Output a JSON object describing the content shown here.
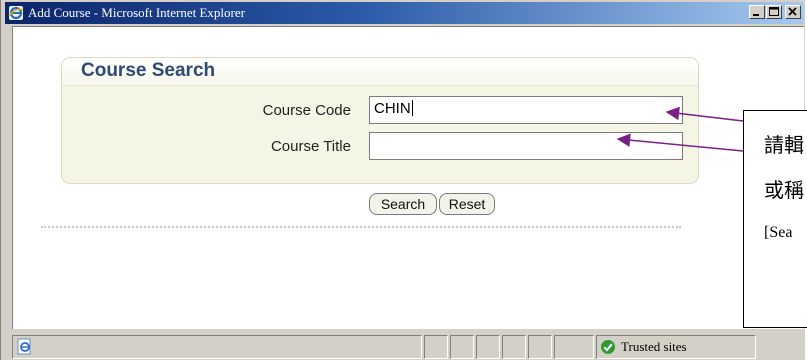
{
  "window": {
    "title": "Add Course - Microsoft Internet Explorer"
  },
  "panel": {
    "title": "Course Search"
  },
  "form": {
    "course_code_label": "Course Code",
    "course_code_value": "CHIN",
    "course_title_label": "Course Title",
    "course_title_value": "",
    "search_label": "Search",
    "reset_label": "Reset"
  },
  "statusbar": {
    "zone_label": "Trusted sites"
  },
  "callout": {
    "lines": [
      "請輯",
      "或稱",
      "[Sea"
    ]
  },
  "colors": {
    "titlebar_start": "#0a246a",
    "titlebar_end": "#a6caf0",
    "panel_title": "#2f4a72",
    "panel_bg": "#f5f5e5",
    "arrow": "#7a1f86"
  },
  "icons": [
    "ie-logo-icon",
    "minimize-icon",
    "maximize-icon",
    "close-icon",
    "ie-page-icon",
    "trusted-sites-icon"
  ]
}
